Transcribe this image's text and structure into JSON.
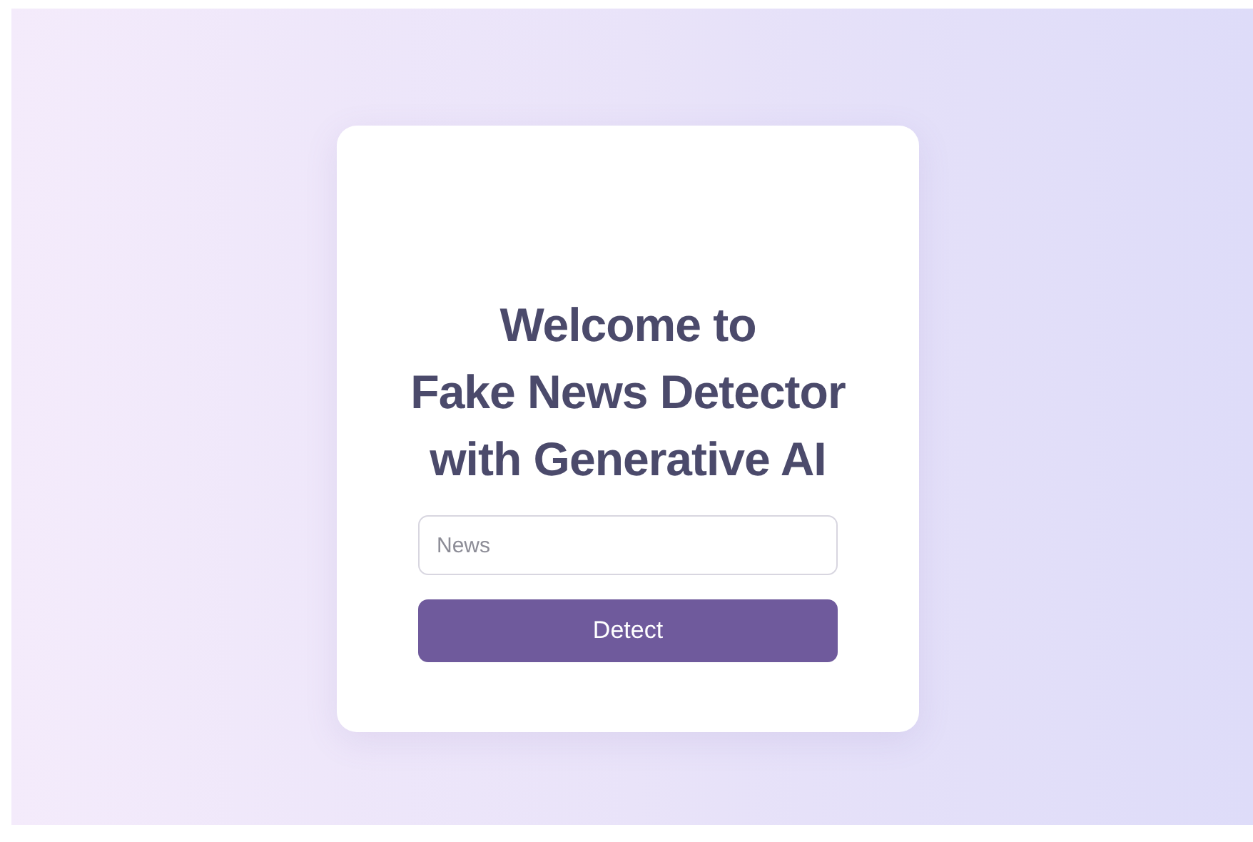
{
  "title_lines": [
    "Welcome to",
    "Fake News Detector",
    "with Generative AI"
  ],
  "input": {
    "placeholder": "News"
  },
  "button": {
    "label": "Detect"
  }
}
